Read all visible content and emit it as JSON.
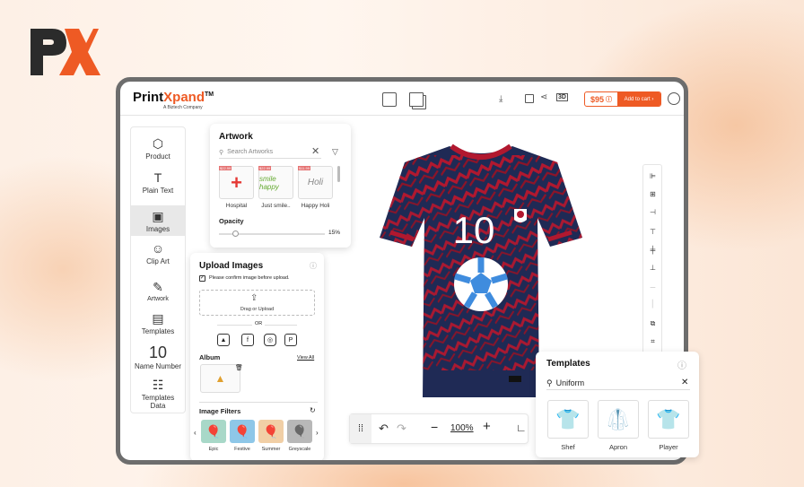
{
  "brand": {
    "name_a": "Print",
    "name_b": "Xpand",
    "tm": "TM",
    "tagline": "A Biztech Company"
  },
  "header": {
    "price": "$95",
    "cart_label": "Add to cart"
  },
  "nav": [
    {
      "label": "Product",
      "icon": "cube-icon"
    },
    {
      "label": "Plain Text",
      "icon": "text-icon"
    },
    {
      "label": "Images",
      "icon": "image-icon"
    },
    {
      "label": "Clip Art",
      "icon": "smiley-icon"
    },
    {
      "label": "Artwork",
      "icon": "brush-icon"
    },
    {
      "label": "Templates",
      "icon": "templates-icon"
    },
    {
      "label": "10",
      "sub": "Name Number",
      "icon": "number-icon"
    },
    {
      "label": "Templates",
      "label2": "Data",
      "icon": "templates-data-icon"
    }
  ],
  "artwork": {
    "title": "Artwork",
    "search_placeholder": "Search Artworks",
    "items": [
      {
        "label": "Hospital",
        "price": "$22.99"
      },
      {
        "label": "Just smile..",
        "price": "$22.99",
        "art": "smile happy"
      },
      {
        "label": "Happy Holi",
        "price": "$11.99",
        "art": "Holi"
      }
    ],
    "opacity_label": "Opacity",
    "opacity_value": "15%",
    "opacity_level": 0.15
  },
  "upload": {
    "title": "Upload Images",
    "confirm": "Please confirm image before upload.",
    "drop_label": "Drag or Upload",
    "or": "OR",
    "album_title": "Album",
    "view_all": "View All",
    "filters_title": "Image Filters",
    "filters": [
      {
        "label": "Epic",
        "color": "#a8d8c8"
      },
      {
        "label": "Festive",
        "color": "#8ec7e8"
      },
      {
        "label": "Summer",
        "color": "#f1cfa6"
      },
      {
        "label": "Greyscale",
        "color": "#b8b8b8"
      }
    ]
  },
  "jersey": {
    "number": "10",
    "navy": "#1f2a55",
    "red": "#b1182f"
  },
  "zoom": {
    "value": "100%"
  },
  "templates": {
    "title": "Templates",
    "search_value": "Uniform",
    "items": [
      {
        "label": "Shef"
      },
      {
        "label": "Apron"
      },
      {
        "label": "Player"
      }
    ]
  }
}
